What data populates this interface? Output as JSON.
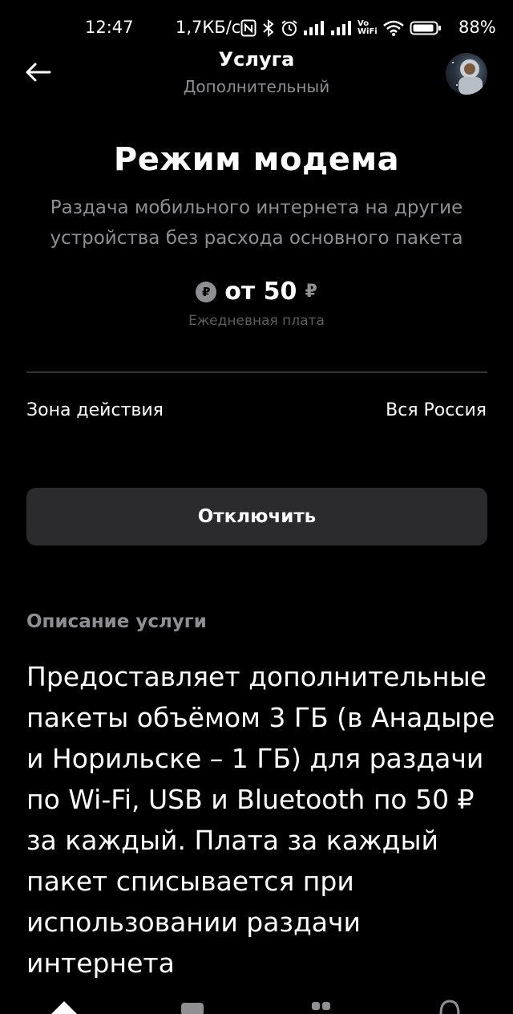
{
  "status_bar": {
    "time": "12:47",
    "net_speed": "1,7КБ/с",
    "battery_percent": "88%",
    "icons": [
      "nfc-icon",
      "bluetooth-icon",
      "alarm-icon",
      "signal-icon",
      "signal-icon",
      "vowifi-icon",
      "wifi-icon",
      "battery-icon"
    ],
    "vowifi_label_top": "Vo",
    "vowifi_label_bottom": "WiFi"
  },
  "header": {
    "title": "Услуга",
    "subtitle": "Дополнительный"
  },
  "service": {
    "title": "Режим модема",
    "description": "Раздача мобильного интернета на другие устройства без расхода основного пакета",
    "price_icon_glyph": "₽",
    "price": "от 50",
    "currency": "₽",
    "price_caption": "Ежедневная плата"
  },
  "zone": {
    "label": "Зона действия",
    "value": "Вся Россия"
  },
  "actions": {
    "disable_label": "Отключить"
  },
  "description_section": {
    "heading": "Описание услуги",
    "body": "Предоставляет дополнительные пакеты объёмом 3 ГБ (в Анадыре и Норильске – 1 ГБ) для раздачи по Wi-Fi, USB и Bluetooth по 50 ₽ за каждый. Плата за каждый пакет списывается при использовании раздачи интернета"
  },
  "bottom_nav": {
    "items": [
      "home-icon",
      "wallet-icon",
      "services-icon",
      "support-icon"
    ]
  }
}
